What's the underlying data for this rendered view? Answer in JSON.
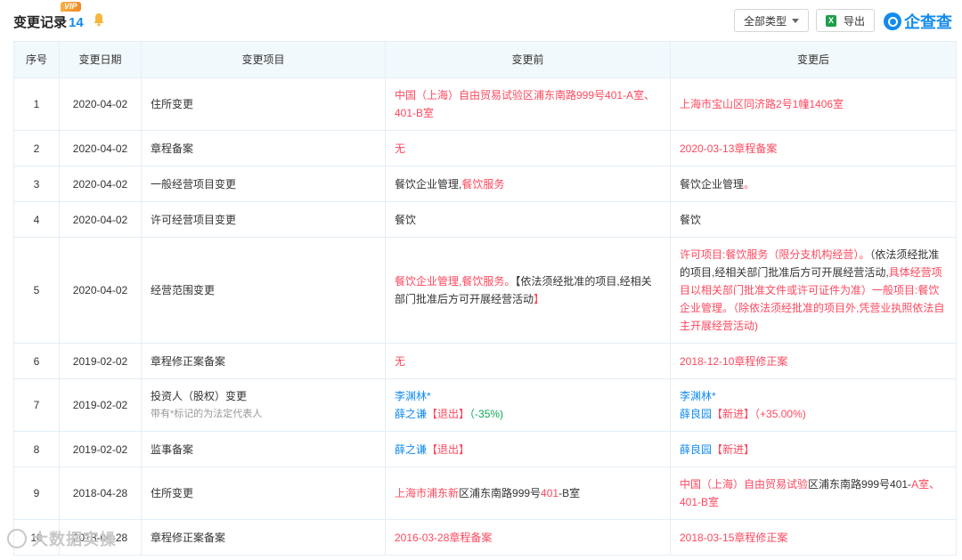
{
  "header": {
    "title": "变更记录",
    "count": "14",
    "vip_badge": "VIP",
    "type_filter": "全部类型",
    "export_label": "导出",
    "logo_text": "企查查",
    "logo_icon": "qichacha-logo-icon"
  },
  "table": {
    "columns": [
      "序号",
      "变更日期",
      "变更项目",
      "变更前",
      "变更后"
    ],
    "rows": [
      {
        "no": "1",
        "date": "2020-04-02",
        "item": "住所变更",
        "before": [
          [
            {
              "t": "中国（上海）自由贸易试验区浦东南路999号401-A室、401-B室",
              "c": "mix1"
            }
          ]
        ],
        "after": [
          [
            {
              "t": "上海市宝山区同济路2号1幢1406室",
              "c": "mix2"
            }
          ]
        ]
      },
      {
        "no": "2",
        "date": "2020-04-02",
        "item": "章程备案",
        "before": [
          [
            {
              "t": "无",
              "c": "red"
            }
          ]
        ],
        "after": [
          [
            {
              "t": "2020-03-13章程备案",
              "c": "red"
            }
          ]
        ]
      },
      {
        "no": "3",
        "date": "2020-04-02",
        "item": "一般经营项目变更",
        "before": [
          [
            {
              "t": "餐饮企业管理,",
              "c": ""
            },
            {
              "t": "餐饮服务",
              "c": "red"
            }
          ]
        ],
        "after": [
          [
            {
              "t": "餐饮企业管理",
              "c": ""
            },
            {
              "t": "。",
              "c": "red"
            }
          ]
        ]
      },
      {
        "no": "4",
        "date": "2020-04-02",
        "item": "许可经营项目变更",
        "before": [
          [
            {
              "t": "餐饮",
              "c": ""
            }
          ]
        ],
        "after": [
          [
            {
              "t": "餐饮",
              "c": ""
            }
          ]
        ]
      },
      {
        "no": "5",
        "date": "2020-04-02",
        "item": "经营范围变更",
        "before": [
          [
            {
              "t": "餐饮企业管理,餐饮服务。",
              "c": "red"
            },
            {
              "t": "【依法须经批准的项目,经相关部门批准后方可开展经营活动",
              "c": ""
            },
            {
              "t": "】",
              "c": "red"
            }
          ]
        ],
        "after": [
          [
            {
              "t": "许可项目:餐饮服务（限分支机构经营）。",
              "c": "red"
            },
            {
              "t": "（依法须经批准的项目,经相关部门批准后方可开展经营活动,",
              "c": ""
            },
            {
              "t": "具体经营项目以相关部门批准文件或许可证件为准）一般项目:餐饮企业管理。（除依法须经批准的项目外,凭营业执照依法自主开展经营活动)",
              "c": "red"
            }
          ]
        ]
      },
      {
        "no": "6",
        "date": "2019-02-02",
        "item": "章程修正案备案",
        "before": [
          [
            {
              "t": "无",
              "c": "red"
            }
          ]
        ],
        "after": [
          [
            {
              "t": "2018-12-10章程修正案",
              "c": "red"
            }
          ]
        ]
      },
      {
        "no": "7",
        "date": "2019-02-02",
        "item": "投资人（股权）变更",
        "item_note": "带有*标记的为法定代表人",
        "before": [
          [
            {
              "t": "李渊林*",
              "c": "blue"
            }
          ],
          [
            {
              "t": "薛之谦",
              "c": "blue"
            },
            {
              "t": "【退出】",
              "c": "red"
            },
            {
              "t": "（-35%)",
              "c": "green"
            }
          ]
        ],
        "after": [
          [
            {
              "t": "李渊林*",
              "c": "blue"
            }
          ],
          [
            {
              "t": "薛良园",
              "c": "blue"
            },
            {
              "t": "【新进】",
              "c": "red"
            },
            {
              "t": "（+35.00%)",
              "c": "red"
            }
          ]
        ]
      },
      {
        "no": "8",
        "date": "2019-02-02",
        "item": "监事备案",
        "before": [
          [
            {
              "t": "薛之谦",
              "c": "blue"
            },
            {
              "t": "【退出】",
              "c": "red"
            }
          ]
        ],
        "after": [
          [
            {
              "t": "薛良园",
              "c": "blue"
            },
            {
              "t": "【新进】",
              "c": "red"
            }
          ]
        ]
      },
      {
        "no": "9",
        "date": "2018-04-28",
        "item": "住所变更",
        "before": [
          [
            {
              "t": "上海市浦东新",
              "c": "red"
            },
            {
              "t": "区浦东南路999号",
              "c": ""
            },
            {
              "t": "401",
              "c": "red"
            },
            {
              "t": "-B室",
              "c": ""
            }
          ]
        ],
        "after": [
          [
            {
              "t": "中国（上海）自由贸易试验",
              "c": "red"
            },
            {
              "t": "区浦东南路999号401-",
              "c": ""
            },
            {
              "t": "A",
              "c": "red"
            },
            {
              "t": "室、401-B室",
              "c": "red"
            }
          ]
        ]
      },
      {
        "no": "10",
        "date": "2018-04-28",
        "item": "章程修正案备案",
        "before": [
          [
            {
              "t": "2016-03-28章程备案",
              "c": "red"
            }
          ]
        ],
        "after": [
          [
            {
              "t": "2018-03-15章程修正案",
              "c": "red"
            }
          ]
        ]
      }
    ]
  },
  "watermark": "大数据实操",
  "colors": {
    "accent": "#128bed",
    "red": "#fd485e",
    "green": "#0aa858",
    "header_bg": "#f2f9fc",
    "border": "#e4eef6"
  }
}
